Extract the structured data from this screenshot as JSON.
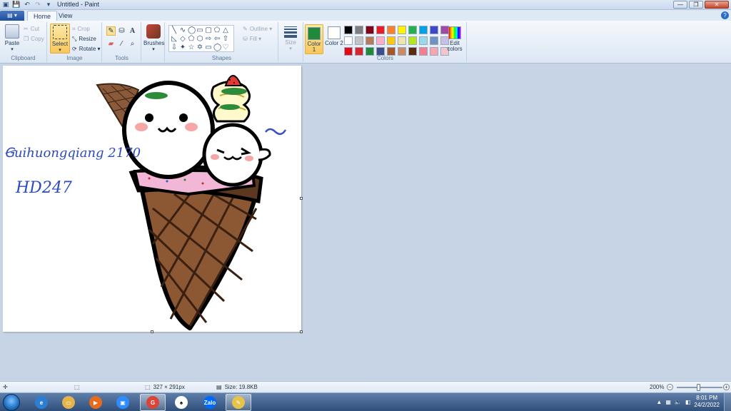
{
  "window": {
    "title": "Untitled - Paint",
    "controls": {
      "minimize": "—",
      "maximize": "❐",
      "close": "✕"
    }
  },
  "ribbon_tabs": {
    "file": "▤ ▾",
    "home": "Home",
    "view": "View"
  },
  "clipboard": {
    "paste": "Paste",
    "cut": "Cut",
    "copy": "Copy",
    "label": "Clipboard"
  },
  "image": {
    "select": "Select",
    "crop": "Crop",
    "resize": "Resize",
    "rotate": "Rotate ▾",
    "label": "Image"
  },
  "tools": {
    "label": "Tools",
    "text_tool": "A"
  },
  "brushes": {
    "label": "Brushes"
  },
  "shapes": {
    "label": "Shapes",
    "outline": "Outline ▾",
    "fill": "Fill ▾"
  },
  "size": {
    "label": "Size"
  },
  "colors": {
    "color1_label": "Color 1",
    "color2_label": "Color 2",
    "color1_value": "#1e8a3a",
    "color2_value": "#ffffff",
    "edit_label": "Edit colors",
    "label": "Colors",
    "palette": [
      "#000000",
      "#7f7f7f",
      "#880015",
      "#ed1c24",
      "#ff7f27",
      "#fff200",
      "#22b14c",
      "#00a2e8",
      "#3f48cc",
      "#a349a4",
      "#ffffff",
      "#c3c3c3",
      "#b97a57",
      "#ffaec9",
      "#ffc90e",
      "#efe4b0",
      "#b5e61d",
      "#99d9ea",
      "#7092be",
      "#c8bfe7",
      "#e30b17",
      "#d7262e",
      "#1e8a3a",
      "#3a4f8c",
      "#a5562b",
      "#c98a6a",
      "#5b2a0f",
      "#f08090",
      "#f7a6b0",
      "#f2c6d0"
    ]
  },
  "canvas": {
    "signature_line1": "Ꞡuihuongqiang 2170",
    "signature_line2": "HD247"
  },
  "statusbar": {
    "dimensions": "327 × 291px",
    "file_size": "Size: 19.8KB",
    "zoom": "200%"
  },
  "taskbar": {
    "apps": [
      {
        "name": "ie",
        "label": "e",
        "color": "#2a7fd4"
      },
      {
        "name": "explorer",
        "label": "▭",
        "color": "#e4b34a"
      },
      {
        "name": "media",
        "label": "▶",
        "color": "#e86a1c"
      },
      {
        "name": "zoom",
        "label": "▣",
        "color": "#2d8cff"
      },
      {
        "name": "chrome",
        "label": "G",
        "color": "#db4437"
      },
      {
        "name": "solitaire",
        "label": "♠",
        "color": "#ffffff"
      },
      {
        "name": "zalo",
        "label": "Zalo",
        "color": "#0068ff"
      },
      {
        "name": "paint",
        "label": "✎",
        "color": "#e6c34a"
      }
    ],
    "time": "8:01 PM",
    "date": "24/2/2022"
  }
}
